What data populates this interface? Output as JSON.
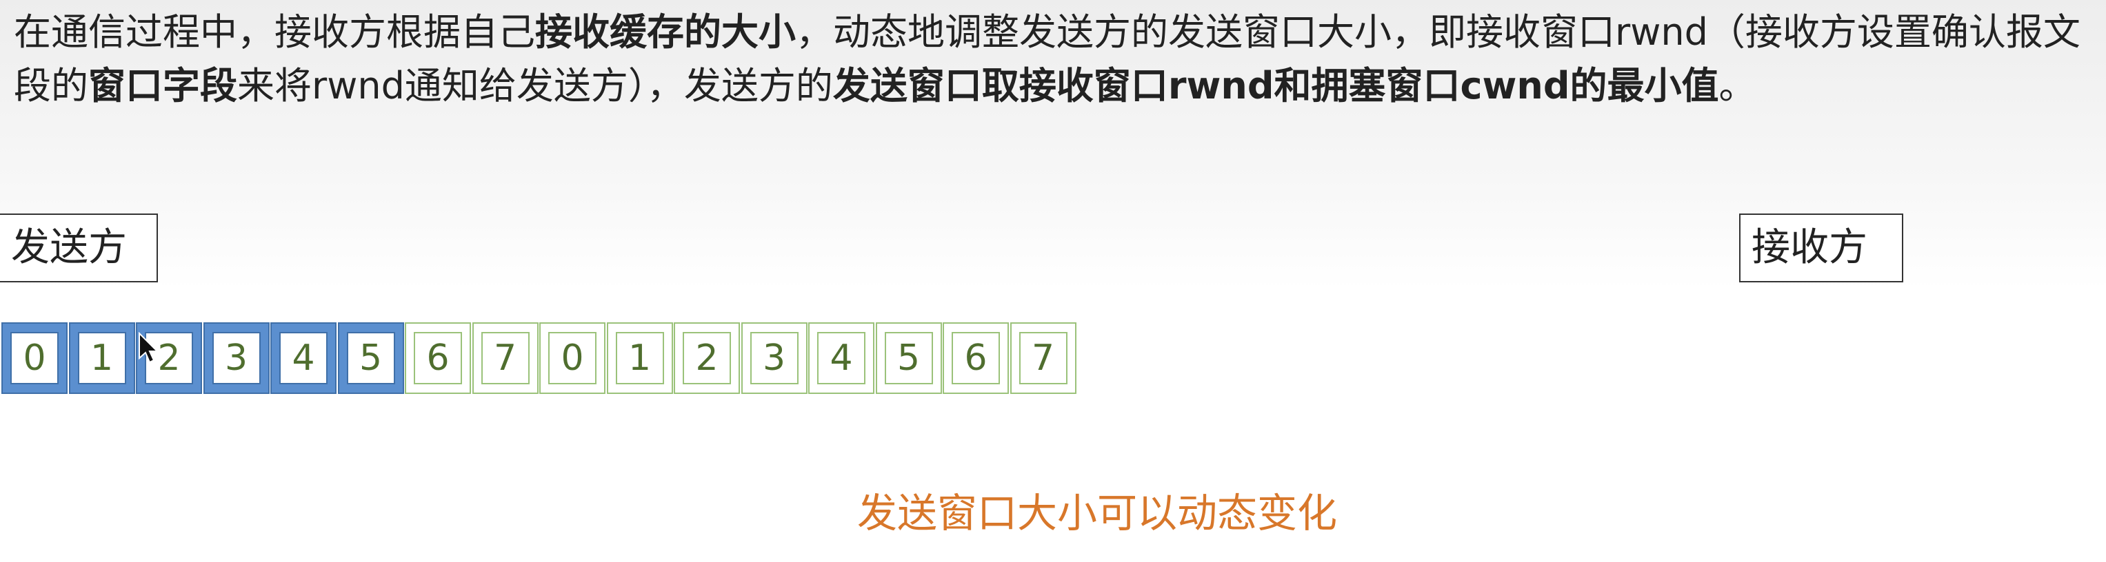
{
  "paragraph": {
    "p1": "在通信过程中，接收方根据自己",
    "b1": "接收缓存的大小",
    "p2": "，动态地调整发送方的发送窗口大小，即接收窗口rwnd（接收方设置确认报文段的",
    "b2": "窗口字段",
    "p3": "来将rwnd通知给发送方），发送方的",
    "b3": "发送窗口取接收窗口rwnd和拥塞窗口cwnd的最小值",
    "p4": "。"
  },
  "sender_label": "发送方",
  "receiver_label": "接收方",
  "cells": [
    {
      "label": "0",
      "state": "sent"
    },
    {
      "label": "1",
      "state": "sent"
    },
    {
      "label": "2",
      "state": "sent"
    },
    {
      "label": "3",
      "state": "sent"
    },
    {
      "label": "4",
      "state": "sent"
    },
    {
      "label": "5",
      "state": "sent"
    },
    {
      "label": "6",
      "state": "plain"
    },
    {
      "label": "7",
      "state": "plain"
    },
    {
      "label": "0",
      "state": "plain"
    },
    {
      "label": "1",
      "state": "plain"
    },
    {
      "label": "2",
      "state": "plain"
    },
    {
      "label": "3",
      "state": "plain"
    },
    {
      "label": "4",
      "state": "plain"
    },
    {
      "label": "5",
      "state": "plain"
    },
    {
      "label": "6",
      "state": "plain"
    },
    {
      "label": "7",
      "state": "plain"
    }
  ],
  "caption": "发送窗口大小可以动态变化",
  "colors": {
    "sent_fill": "#5b8fcf",
    "cell_border": "#9bc27a",
    "caption": "#d8772a"
  }
}
